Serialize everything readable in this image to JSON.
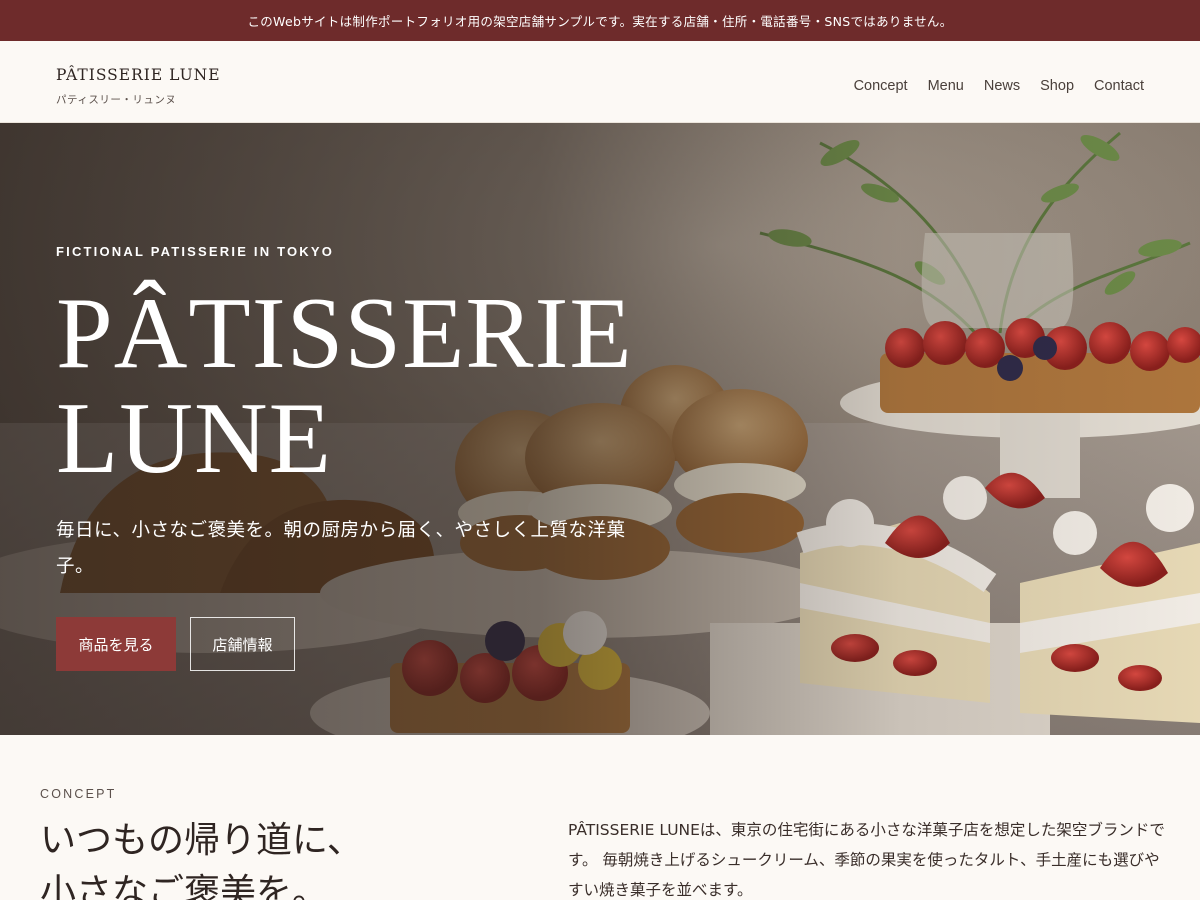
{
  "notice": "このWebサイトは制作ポートフォリオ用の架空店舗サンプルです。実在する店舗・住所・電話番号・SNSではありません。",
  "brand": {
    "name": "PÂTISSERIE LUNE",
    "kana": "パティスリー・リュンヌ"
  },
  "nav": [
    "Concept",
    "Menu",
    "News",
    "Shop",
    "Contact"
  ],
  "hero": {
    "eyebrow": "FICTIONAL PATISSERIE IN TOKYO",
    "title_line1": "PÂTISSERIE",
    "title_line2": "LUNE",
    "lead": "毎日に、小さなご褒美を。朝の厨房から届く、やさしく上質な洋菓子。",
    "primary_button": "商品を見る",
    "secondary_button": "店舗情報"
  },
  "concept": {
    "eyebrow": "CONCEPT",
    "heading_line1": "いつもの帰り道に、",
    "heading_line2": "小さなご褒美を。",
    "body": "PÂTISSERIE LUNEは、東京の住宅街にある小さな洋菓子店を想定した架空ブランドです。 毎朝焼き上げるシュークリーム、季節の果実を使ったタルト、手土産にも選びやすい焼き菓子を並べます。"
  },
  "colors": {
    "notice_bg": "#6e2b2b",
    "accent": "#8d3a38",
    "page_bg": "#fcf9f5"
  }
}
